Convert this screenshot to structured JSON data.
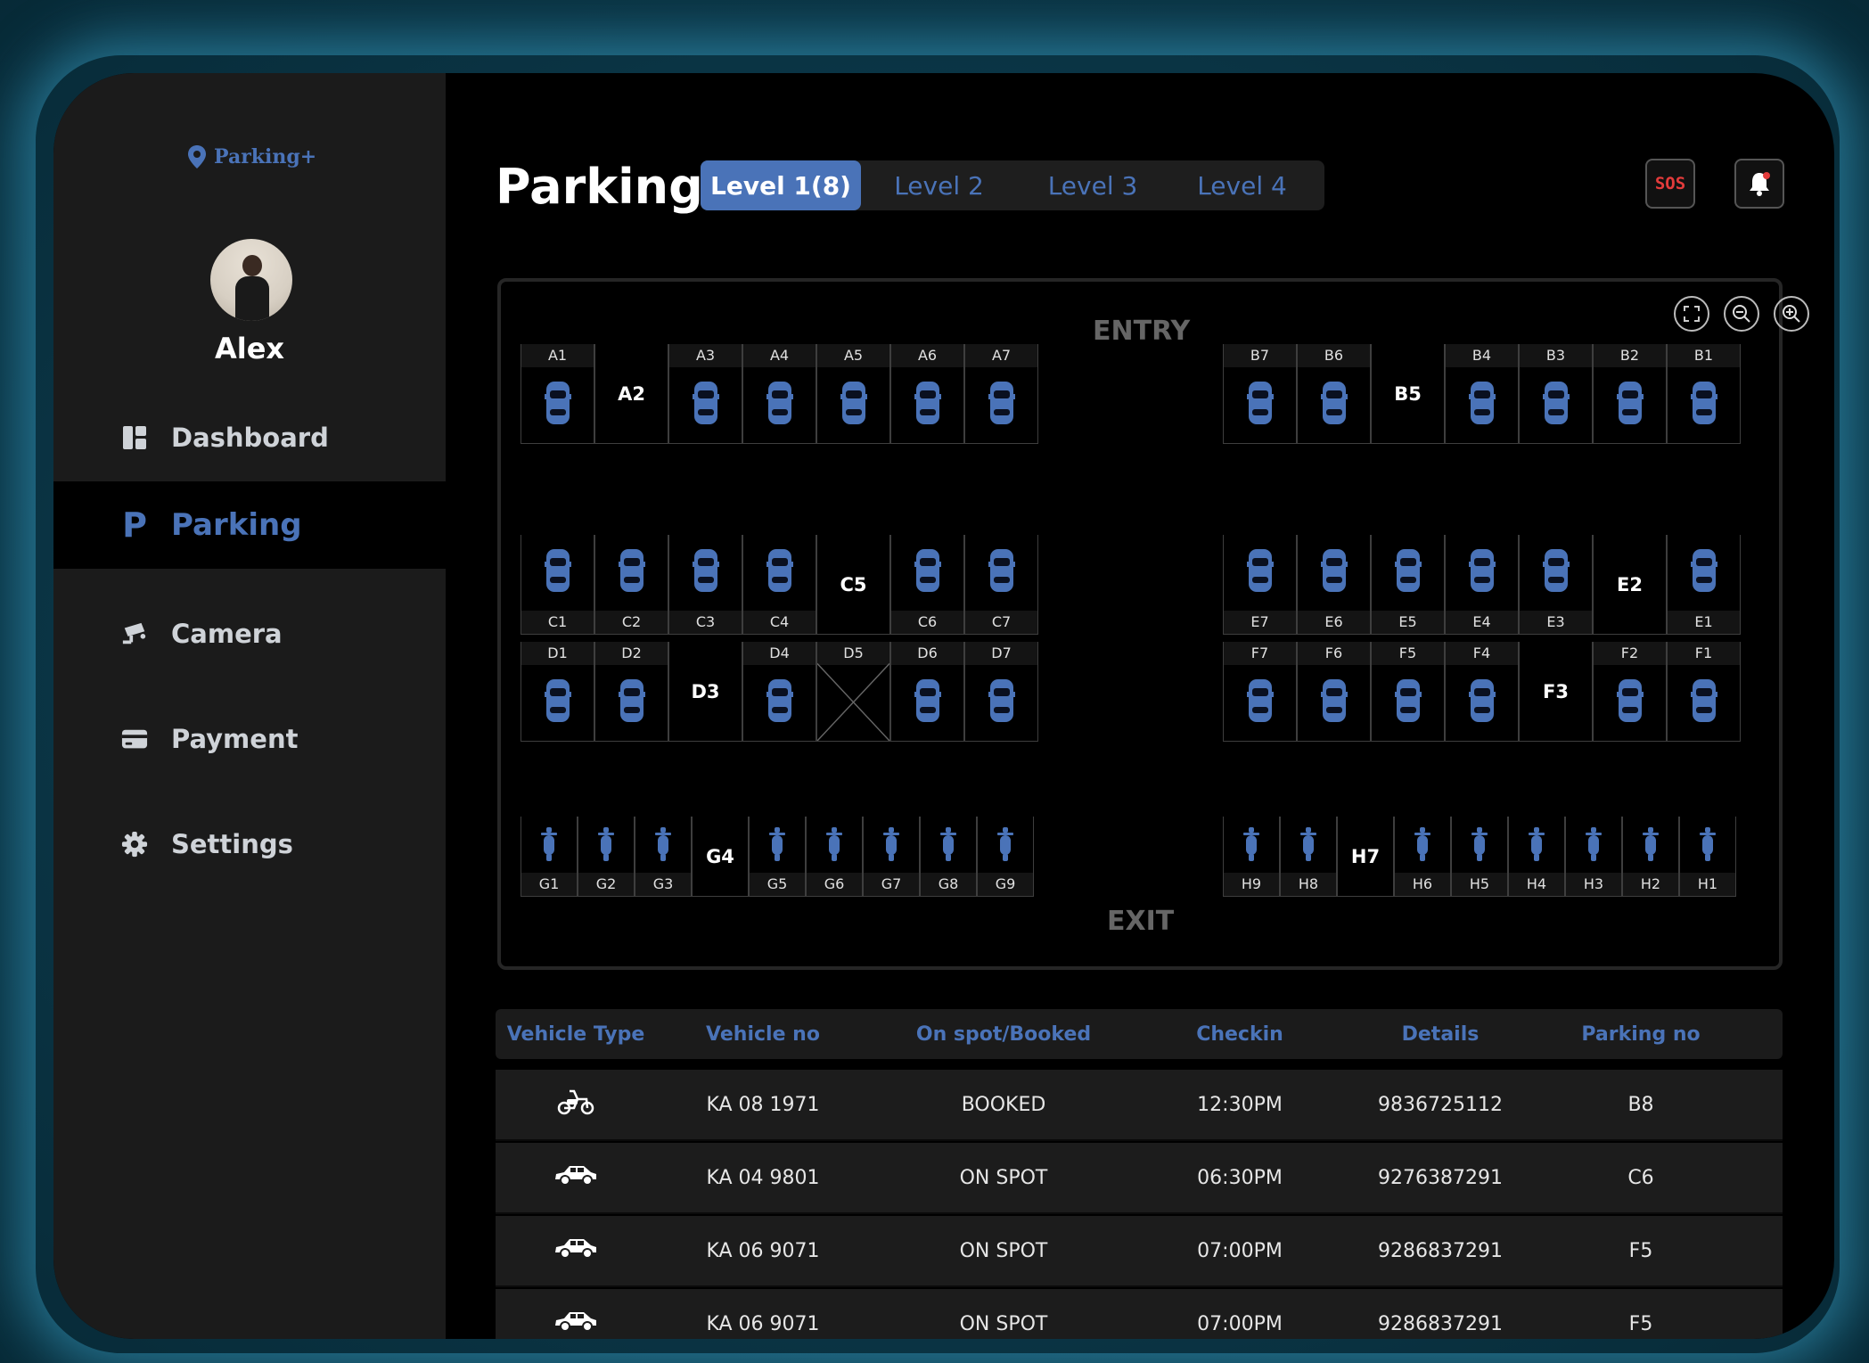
{
  "app": {
    "logo_text": "Parking+",
    "user_name": "Alex"
  },
  "nav": [
    {
      "label": "Dashboard",
      "icon": "dashboard-icon"
    },
    {
      "label": "Parking",
      "icon": "parking-icon",
      "active": true
    },
    {
      "label": "Camera",
      "icon": "camera-icon"
    },
    {
      "label": "Payment",
      "icon": "card-icon"
    },
    {
      "label": "Settings",
      "icon": "gear-icon"
    }
  ],
  "header": {
    "title": "Parking",
    "tabs": [
      "Level 1(8)",
      "Level 2",
      "Level 3",
      "Level 4"
    ],
    "active_tab": 0,
    "sos_label": "SOS"
  },
  "map": {
    "entry_label": "ENTRY",
    "exit_label": "EXIT",
    "blocks": {
      "A": [
        "A1",
        "A2",
        "A3",
        "A4",
        "A5",
        "A6",
        "A7"
      ],
      "B": [
        "B7",
        "B6",
        "B5",
        "B4",
        "B3",
        "B2",
        "B1"
      ],
      "C": [
        "C1",
        "C2",
        "C3",
        "C4",
        "C5",
        "C6",
        "C7"
      ],
      "E": [
        "E7",
        "E6",
        "E5",
        "E4",
        "E3",
        "E2",
        "E1"
      ],
      "D": [
        "D1",
        "D2",
        "D3",
        "D4",
        "D5",
        "D6",
        "D7"
      ],
      "F": [
        "F7",
        "F6",
        "F5",
        "F4",
        "F3",
        "F2",
        "F1"
      ],
      "G": [
        "G1",
        "G2",
        "G3",
        "G4",
        "G5",
        "G6",
        "G7",
        "G8",
        "G9"
      ],
      "H": [
        "H9",
        "H8",
        "H7",
        "H6",
        "H5",
        "H4",
        "H3",
        "H2",
        "H1"
      ]
    },
    "free_spots": [
      "A2",
      "B5",
      "C5",
      "E2",
      "D3",
      "F3",
      "G4",
      "H7"
    ],
    "blocked_spots": [
      "D5"
    ]
  },
  "table": {
    "headers": [
      "Vehicle Type",
      "Vehicle no",
      "On spot/Booked",
      "Checkin",
      "Details",
      "Parking no"
    ],
    "rows": [
      {
        "type_icon": "scooter-icon",
        "vehicle_no": "KA 08 1971",
        "status": "BOOKED",
        "checkin": "12:30PM",
        "details": "9836725112",
        "parking_no": "B8"
      },
      {
        "type_icon": "car-icon",
        "vehicle_no": "KA 04 9801",
        "status": "ON SPOT",
        "checkin": "06:30PM",
        "details": "9276387291",
        "parking_no": "C6"
      },
      {
        "type_icon": "car-icon",
        "vehicle_no": "KA 06 9071",
        "status": "ON SPOT",
        "checkin": "07:00PM",
        "details": "9286837291",
        "parking_no": "F5"
      },
      {
        "type_icon": "car-icon",
        "vehicle_no": "KA 06 9071",
        "status": "ON SPOT",
        "checkin": "07:00PM",
        "details": "9286837291",
        "parking_no": "F5"
      }
    ]
  },
  "colors": {
    "accent": "#4a73b8",
    "sos": "#e23b3b",
    "background": "#000000",
    "sidebar": "#1b1b1b"
  }
}
